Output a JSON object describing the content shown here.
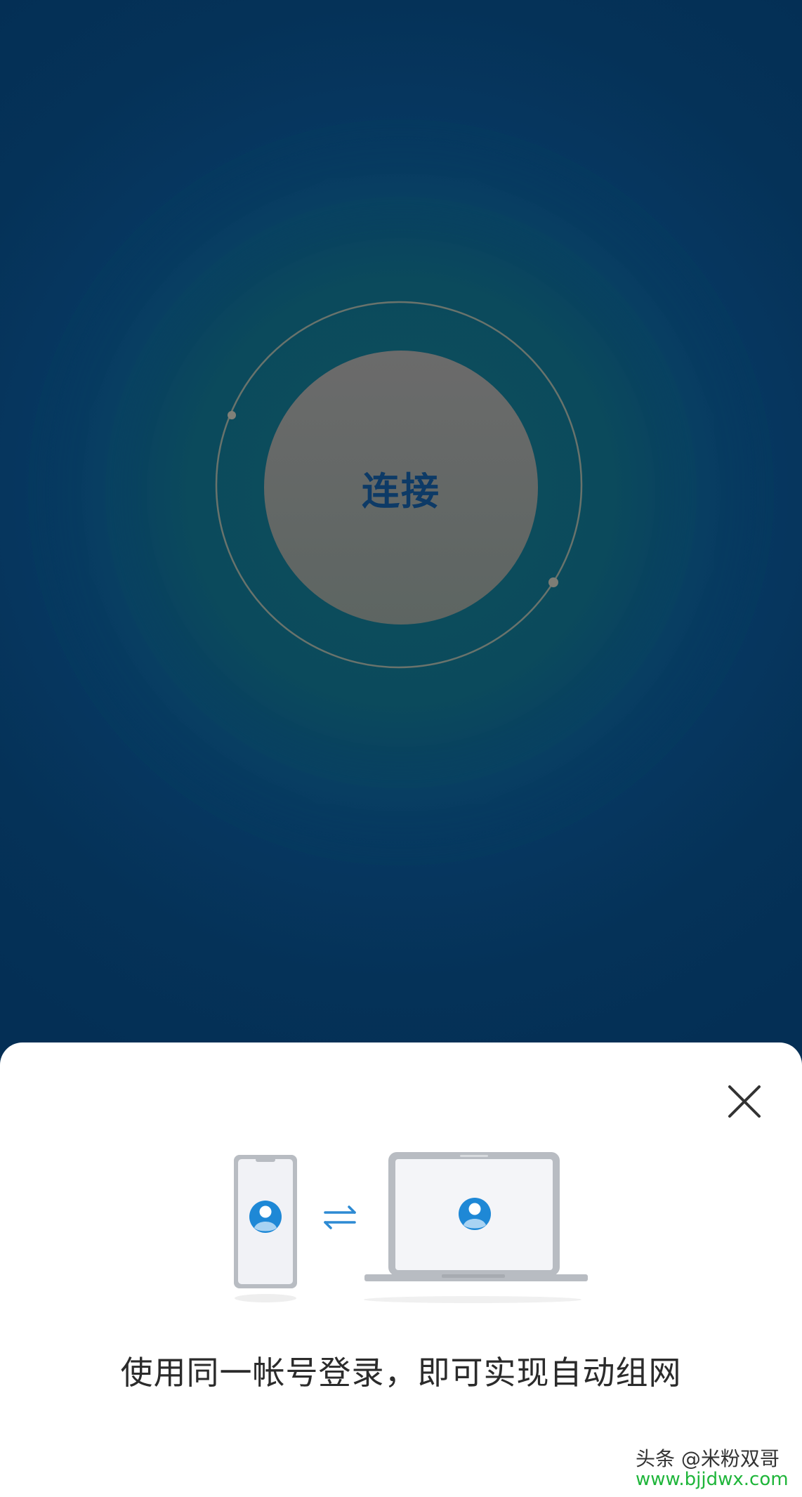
{
  "main": {
    "connect_label": "连接"
  },
  "sheet": {
    "description": "使用同一帐号登录，即可实现自动组网",
    "close_icon": "close-icon",
    "illustration": {
      "left_device": "phone-icon",
      "middle": "swap-arrows-icon",
      "right_device": "laptop-icon",
      "avatar_icon": "user-avatar-icon"
    }
  },
  "watermark": {
    "author": "头条 @米粉双哥",
    "site": "www.bjjdwx.com"
  },
  "colors": {
    "background": "#042e54",
    "connect_circle": "#676767",
    "connect_text": "#0d3a66",
    "sheet": "#ffffff",
    "avatar_blue": "#1e88d6",
    "arrow_blue": "#2d8ad3",
    "device_gray": "#b8bcc2",
    "watermark_green": "#1fb53a"
  }
}
